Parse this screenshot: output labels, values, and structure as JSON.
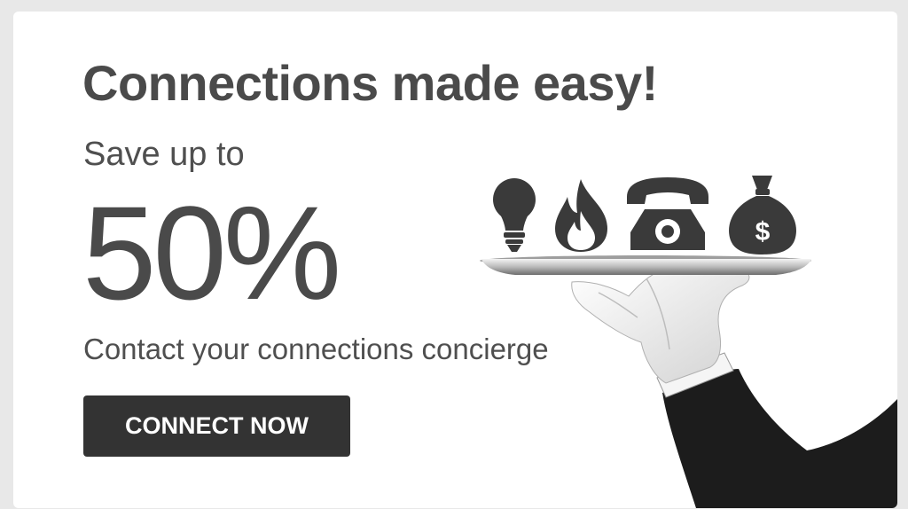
{
  "promo": {
    "headline": "Connections made easy!",
    "subheadline": "Save up to",
    "discount": "50%",
    "tagline": "Contact your connections concierge",
    "cta_label": "CONNECT NOW"
  },
  "illustration": {
    "icons": [
      "lightbulb-icon",
      "flame-icon",
      "telephone-icon",
      "money-bag-icon"
    ],
    "money_bag_symbol": "$"
  },
  "colors": {
    "page_background": "#e8e8e8",
    "card_background": "#ffffff",
    "text_primary": "#4a4a4a",
    "button_background": "#333333",
    "button_text": "#ffffff"
  }
}
